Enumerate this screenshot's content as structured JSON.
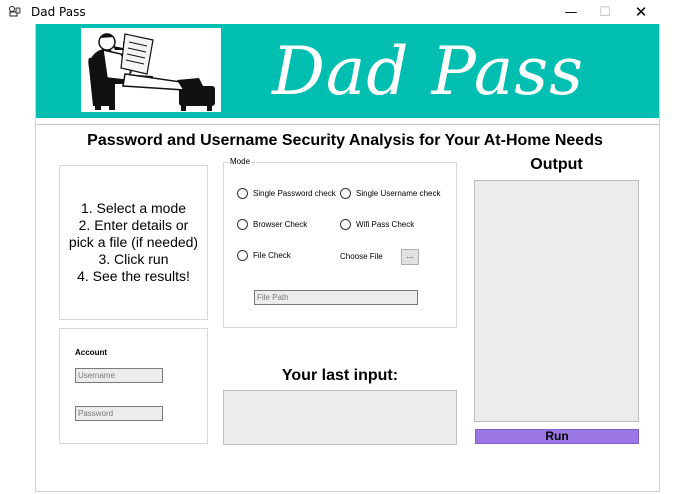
{
  "window": {
    "title": "Dad Pass",
    "minimize": "—",
    "maximize": "☐",
    "close": "✕"
  },
  "banner": {
    "title": "Dad Pass",
    "background_color": "#00bfb0"
  },
  "subtitle": "Password and Username Security Analysis for Your At-Home Needs",
  "instructions": [
    "1. Select a mode",
    "2. Enter details or",
    "pick a file (if needed)",
    "3. Click run",
    "4. See the results!"
  ],
  "mode": {
    "label": "Mode",
    "options": {
      "single_password": "Single Password check",
      "single_username": "Single Username check",
      "browser": "Browser Check",
      "wifi": "Wifi Pass Check",
      "file": "File Check"
    },
    "choose_file_label": "Choose File",
    "choose_file_button": "...",
    "file_path_placeholder": "File Path"
  },
  "account": {
    "label": "Account",
    "username_placeholder": "Username",
    "password_placeholder": "Password"
  },
  "last_input_heading": "Your last input:",
  "output_heading": "Output",
  "run_label": "Run",
  "colors": {
    "run_button": "#9b78e4",
    "field_bg": "#ececec"
  }
}
